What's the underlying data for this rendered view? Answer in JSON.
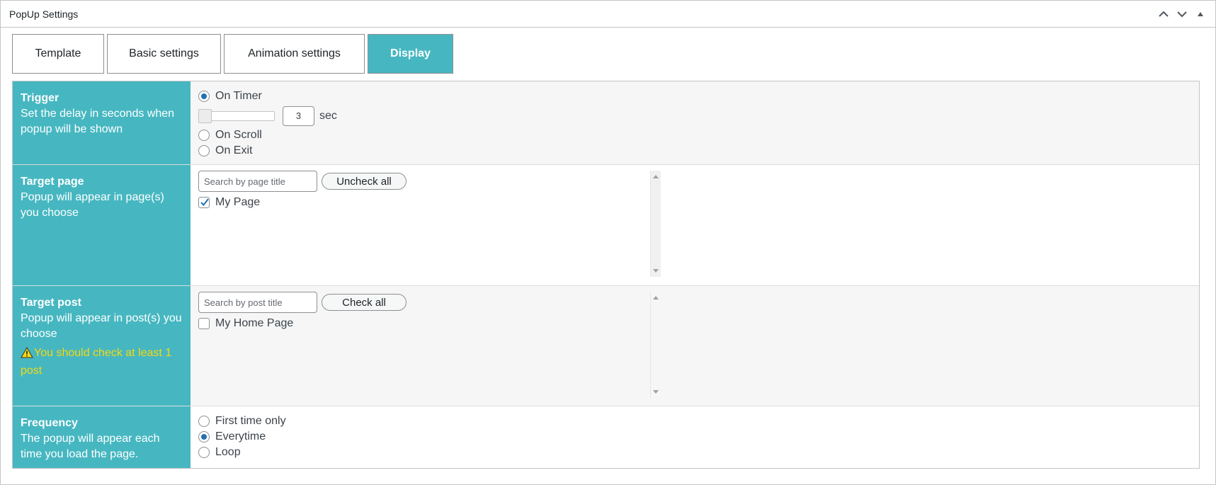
{
  "panel": {
    "title": "PopUp Settings"
  },
  "tabs": [
    {
      "label": "Template",
      "active": false
    },
    {
      "label": "Basic settings",
      "active": false
    },
    {
      "label": "Animation settings",
      "active": false
    },
    {
      "label": "Display",
      "active": true
    }
  ],
  "trigger": {
    "title": "Trigger",
    "description": "Set the delay in seconds when popup will be shown",
    "options": [
      {
        "label": "On Timer",
        "checked": true
      },
      {
        "label": "On Scroll",
        "checked": false
      },
      {
        "label": "On Exit",
        "checked": false
      }
    ],
    "delay_value": "3",
    "delay_unit": "sec"
  },
  "target_page": {
    "title": "Target page",
    "description": "Popup will appear in page(s) you choose",
    "search_placeholder": "Search by page title",
    "toggle_button": "Uncheck all",
    "items": [
      {
        "label": "My Page",
        "checked": true
      }
    ]
  },
  "target_post": {
    "title": "Target post",
    "description": "Popup will appear in post(s) you choose",
    "warning": "You should check at least 1 post",
    "search_placeholder": "Search by post title",
    "toggle_button": "Check all",
    "items": [
      {
        "label": "My Home Page",
        "checked": false
      }
    ]
  },
  "frequency": {
    "title": "Frequency",
    "description": "The popup will appear each time you load the page.",
    "options": [
      {
        "label": "First time only",
        "checked": false
      },
      {
        "label": "Everytime",
        "checked": true
      },
      {
        "label": "Loop",
        "checked": false
      }
    ]
  },
  "colors": {
    "accent": "#46b7c1",
    "radio_checked": "#2271b1",
    "warning": "#f5d90f"
  }
}
